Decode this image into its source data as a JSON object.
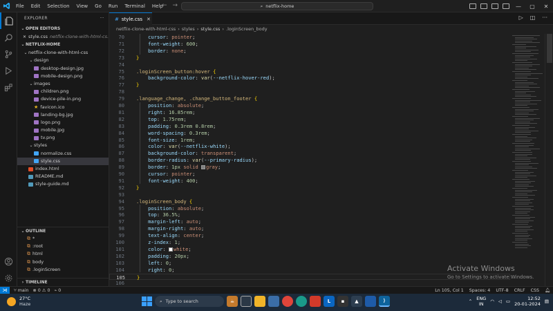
{
  "menu": [
    "File",
    "Edit",
    "Selection",
    "View",
    "Go",
    "Run",
    "Terminal",
    "Help"
  ],
  "command_center": "netflix-home",
  "explorer": {
    "title": "EXPLORER",
    "open_editors_label": "OPEN EDITORS",
    "open_editor_file": "style.css",
    "open_editor_path": "netflix-clone-with-html-cs...",
    "project_label": "NETFLIX-HOME",
    "tree": [
      {
        "label": "netflix-clone-with-html-css",
        "type": "folder",
        "depth": 0
      },
      {
        "label": "design",
        "type": "folder",
        "depth": 1
      },
      {
        "label": "desktop-design.jpg",
        "type": "img",
        "depth": 2
      },
      {
        "label": "mobile-design.png",
        "type": "img",
        "depth": 2
      },
      {
        "label": "images",
        "type": "folder",
        "depth": 1
      },
      {
        "label": "children.png",
        "type": "img",
        "depth": 2
      },
      {
        "label": "device-pile-in.png",
        "type": "img",
        "depth": 2
      },
      {
        "label": "favicon.ico",
        "type": "star",
        "depth": 2
      },
      {
        "label": "landing-bg.jpg",
        "type": "img",
        "depth": 2
      },
      {
        "label": "logo.png",
        "type": "img",
        "depth": 2
      },
      {
        "label": "mobile.jpg",
        "type": "img",
        "depth": 2
      },
      {
        "label": "tv.png",
        "type": "img",
        "depth": 2
      },
      {
        "label": "styles",
        "type": "folder",
        "depth": 1
      },
      {
        "label": "normalize.css",
        "type": "css",
        "depth": 2
      },
      {
        "label": "style.css",
        "type": "css",
        "depth": 2,
        "selected": true
      },
      {
        "label": "index.html",
        "type": "html",
        "depth": 1
      },
      {
        "label": "README.md",
        "type": "md",
        "depth": 1
      },
      {
        "label": "style-guide.md",
        "type": "md",
        "depth": 1
      }
    ],
    "outline_label": "OUTLINE",
    "outline": [
      "*",
      ":root",
      "html",
      "body",
      ".loginScreen"
    ],
    "timeline_label": "TIMELINE"
  },
  "tab": {
    "label": "style.css"
  },
  "breadcrumb": [
    "netflix-clone-with-html-css",
    "styles",
    "style.css",
    ".loginScreen_body"
  ],
  "code": [
    {
      "n": "70",
      "t": [
        [
          "    ",
          ""
        ],
        [
          "cursor",
          "prop"
        ],
        [
          ": ",
          "pun"
        ],
        [
          "pointer",
          "val"
        ],
        [
          ";",
          "pun"
        ]
      ]
    },
    {
      "n": "71",
      "t": [
        [
          "    ",
          ""
        ],
        [
          "font-weight",
          "prop"
        ],
        [
          ": ",
          "pun"
        ],
        [
          "600",
          "num"
        ],
        [
          ";",
          "pun"
        ]
      ]
    },
    {
      "n": "72",
      "t": [
        [
          "    ",
          ""
        ],
        [
          "border",
          "prop"
        ],
        [
          ": ",
          "pun"
        ],
        [
          "none",
          "val"
        ],
        [
          ";",
          "pun"
        ]
      ]
    },
    {
      "n": "73",
      "t": [
        [
          "}",
          "brace"
        ]
      ]
    },
    {
      "n": "74",
      "t": []
    },
    {
      "n": "75",
      "t": [
        [
          ".loginScreen_button:hover",
          "sel"
        ],
        [
          " ",
          ""
        ],
        [
          "{",
          "brace"
        ]
      ]
    },
    {
      "n": "76",
      "t": [
        [
          "    ",
          ""
        ],
        [
          "background-color",
          "prop"
        ],
        [
          ": ",
          "pun"
        ],
        [
          "var",
          "fn"
        ],
        [
          "(",
          "pun"
        ],
        [
          "--netflix-hover-red",
          "var"
        ],
        [
          ");",
          "pun"
        ]
      ]
    },
    {
      "n": "77",
      "t": [
        [
          "}",
          "brace"
        ]
      ]
    },
    {
      "n": "78",
      "t": []
    },
    {
      "n": "79",
      "t": [
        [
          ".language_change, .change_button_footer",
          "sel"
        ],
        [
          " ",
          ""
        ],
        [
          "{",
          "brace"
        ]
      ]
    },
    {
      "n": "80",
      "t": [
        [
          "    ",
          ""
        ],
        [
          "position",
          "prop"
        ],
        [
          ": ",
          "pun"
        ],
        [
          "absolute",
          "val"
        ],
        [
          ";",
          "pun"
        ]
      ]
    },
    {
      "n": "81",
      "t": [
        [
          "    ",
          ""
        ],
        [
          "right",
          "prop"
        ],
        [
          ": ",
          "pun"
        ],
        [
          "16.85rem",
          "num"
        ],
        [
          ";",
          "pun"
        ]
      ]
    },
    {
      "n": "82",
      "t": [
        [
          "    ",
          ""
        ],
        [
          "top",
          "prop"
        ],
        [
          ": ",
          "pun"
        ],
        [
          "1.75rem",
          "num"
        ],
        [
          ";",
          "pun"
        ]
      ]
    },
    {
      "n": "83",
      "t": [
        [
          "    ",
          ""
        ],
        [
          "padding",
          "prop"
        ],
        [
          ": ",
          "pun"
        ],
        [
          "0.3rem 0.8rem",
          "num"
        ],
        [
          ";",
          "pun"
        ]
      ]
    },
    {
      "n": "84",
      "t": [
        [
          "    ",
          ""
        ],
        [
          "word-spacing",
          "prop"
        ],
        [
          ": ",
          "pun"
        ],
        [
          "0.3rem",
          "num"
        ],
        [
          ";",
          "pun"
        ]
      ]
    },
    {
      "n": "85",
      "t": [
        [
          "    ",
          ""
        ],
        [
          "font-size",
          "prop"
        ],
        [
          ": ",
          "pun"
        ],
        [
          "1rem",
          "num"
        ],
        [
          ";",
          "pun"
        ]
      ]
    },
    {
      "n": "86",
      "t": [
        [
          "    ",
          ""
        ],
        [
          "color",
          "prop"
        ],
        [
          ": ",
          "pun"
        ],
        [
          "var",
          "fn"
        ],
        [
          "(",
          "pun"
        ],
        [
          "--netflix-white",
          "var"
        ],
        [
          ");",
          "pun"
        ]
      ]
    },
    {
      "n": "87",
      "t": [
        [
          "    ",
          ""
        ],
        [
          "background-color",
          "prop"
        ],
        [
          ": ",
          "pun"
        ],
        [
          "transparent",
          "val"
        ],
        [
          ";",
          "pun"
        ]
      ]
    },
    {
      "n": "88",
      "t": [
        [
          "    ",
          ""
        ],
        [
          "border-radius",
          "prop"
        ],
        [
          ": ",
          "pun"
        ],
        [
          "var",
          "fn"
        ],
        [
          "(",
          "pun"
        ],
        [
          "--primary-radius",
          "var"
        ],
        [
          ");",
          "pun"
        ]
      ]
    },
    {
      "n": "89",
      "t": [
        [
          "    ",
          ""
        ],
        [
          "border",
          "prop"
        ],
        [
          ": ",
          "pun"
        ],
        [
          "1px",
          "num"
        ],
        [
          " ",
          ""
        ],
        [
          "solid",
          "val"
        ],
        [
          " ",
          ""
        ],
        [
          "#808080",
          "swatch"
        ],
        [
          "gray",
          "val"
        ],
        [
          ";",
          "pun"
        ]
      ]
    },
    {
      "n": "90",
      "t": [
        [
          "    ",
          ""
        ],
        [
          "cursor",
          "prop"
        ],
        [
          ": ",
          "pun"
        ],
        [
          "pointer",
          "val"
        ],
        [
          ";",
          "pun"
        ]
      ]
    },
    {
      "n": "91",
      "t": [
        [
          "    ",
          ""
        ],
        [
          "font-weight",
          "prop"
        ],
        [
          ": ",
          "pun"
        ],
        [
          "400",
          "num"
        ],
        [
          ";",
          "pun"
        ]
      ]
    },
    {
      "n": "92",
      "t": [
        [
          "}",
          "brace"
        ]
      ]
    },
    {
      "n": "93",
      "t": []
    },
    {
      "n": "94",
      "t": [
        [
          ".loginScreen_body",
          "sel"
        ],
        [
          " ",
          ""
        ],
        [
          "{",
          "brace"
        ]
      ]
    },
    {
      "n": "95",
      "t": [
        [
          "    ",
          ""
        ],
        [
          "position",
          "prop"
        ],
        [
          ": ",
          "pun"
        ],
        [
          "absolute",
          "val"
        ],
        [
          ";",
          "pun"
        ]
      ]
    },
    {
      "n": "96",
      "t": [
        [
          "    ",
          ""
        ],
        [
          "top",
          "prop"
        ],
        [
          ": ",
          "pun"
        ],
        [
          "36.5%",
          "num"
        ],
        [
          ";",
          "pun"
        ]
      ]
    },
    {
      "n": "97",
      "t": [
        [
          "    ",
          ""
        ],
        [
          "margin-left",
          "prop"
        ],
        [
          ": ",
          "pun"
        ],
        [
          "auto",
          "val"
        ],
        [
          ";",
          "pun"
        ]
      ]
    },
    {
      "n": "98",
      "t": [
        [
          "    ",
          ""
        ],
        [
          "margin-right",
          "prop"
        ],
        [
          ": ",
          "pun"
        ],
        [
          "auto",
          "val"
        ],
        [
          ";",
          "pun"
        ]
      ]
    },
    {
      "n": "99",
      "t": [
        [
          "    ",
          ""
        ],
        [
          "text-align",
          "prop"
        ],
        [
          ": ",
          "pun"
        ],
        [
          "center",
          "val"
        ],
        [
          ";",
          "pun"
        ]
      ]
    },
    {
      "n": "100",
      "t": [
        [
          "    ",
          ""
        ],
        [
          "z-index",
          "prop"
        ],
        [
          ": ",
          "pun"
        ],
        [
          "1",
          "num"
        ],
        [
          ";",
          "pun"
        ]
      ]
    },
    {
      "n": "101",
      "t": [
        [
          "    ",
          ""
        ],
        [
          "color",
          "prop"
        ],
        [
          ": ",
          "pun"
        ],
        [
          "#ffffff",
          "swatch"
        ],
        [
          "white",
          "val"
        ],
        [
          ";",
          "pun"
        ]
      ]
    },
    {
      "n": "102",
      "t": [
        [
          "    ",
          ""
        ],
        [
          "padding",
          "prop"
        ],
        [
          ": ",
          "pun"
        ],
        [
          "20px",
          "num"
        ],
        [
          ";",
          "pun"
        ]
      ]
    },
    {
      "n": "103",
      "t": [
        [
          "    ",
          ""
        ],
        [
          "left",
          "prop"
        ],
        [
          ": ",
          "pun"
        ],
        [
          "0",
          "num"
        ],
        [
          ";",
          "pun"
        ]
      ]
    },
    {
      "n": "104",
      "t": [
        [
          "    ",
          ""
        ],
        [
          "right",
          "prop"
        ],
        [
          ": ",
          "pun"
        ],
        [
          "0",
          "num"
        ],
        [
          ";",
          "pun"
        ]
      ]
    },
    {
      "n": "105",
      "t": [
        [
          "}",
          "brace"
        ]
      ],
      "current": true
    },
    {
      "n": "106",
      "t": []
    }
  ],
  "watermark": {
    "title": "Activate Windows",
    "subtitle": "Go to Settings to activate Windows."
  },
  "status": {
    "branch": "main",
    "errors": "⊗ 0 ⚠ 0",
    "ports": "⌁ 0",
    "position": "Ln 105, Col 1",
    "spaces": "Spaces: 4",
    "encoding": "UTF-8",
    "eol": "CRLF",
    "language": "CSS"
  },
  "taskbar": {
    "temp": "27°C",
    "condition": "Haze",
    "search_placeholder": "Type to search",
    "lang_top": "ENG",
    "lang_bottom": "IN",
    "time": "12:52",
    "date": "20-01-2024"
  },
  "colors": {
    "accent": "#0078d4",
    "editor_bg": "#1f1f1f",
    "selector": "#d7ba7d",
    "property": "#9cdcfe",
    "value": "#ce9178",
    "number": "#b5cea8"
  }
}
